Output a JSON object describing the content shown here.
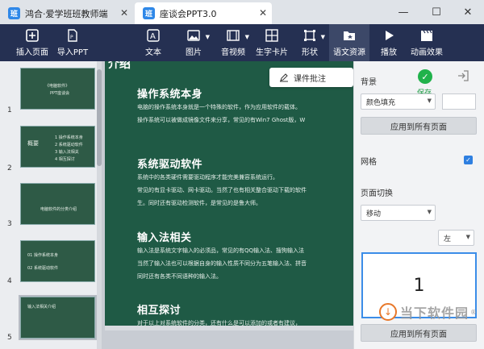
{
  "tabs": [
    {
      "logo": "班",
      "label": "鸿合·爱学班班教师端"
    },
    {
      "logo": "班",
      "label": "座谈会PPT3.0"
    }
  ],
  "window_controls": {
    "minimize": "—",
    "maximize": "☐",
    "close": "✕"
  },
  "toolbar": {
    "insert_page": "插入页面",
    "import_ppt": "导入PPT",
    "text": "文本",
    "image": "图片",
    "audio_video": "音视频",
    "word_card": "生字卡片",
    "shape": "形状",
    "language_resource": "语文资源",
    "play": "播放",
    "animation": "动画效果"
  },
  "thumbnails": [
    {
      "num": "1",
      "lines": [
        "《电脑软件》",
        "PPT座谈会"
      ]
    },
    {
      "num": "2",
      "lines": [
        "概要",
        "1 操作系统本身",
        "2 系统驱动软件",
        "3 输入法相关",
        "4 相互探讨"
      ]
    },
    {
      "num": "3",
      "lines": [
        "电脑软件的分类介绍"
      ]
    },
    {
      "num": "4",
      "lines": [
        "01 操作系统本身",
        "02 系统驱动软件"
      ]
    },
    {
      "num": "5",
      "lines": [
        "输入法相关介绍"
      ]
    }
  ],
  "slide": {
    "ghost_title": "介绍",
    "sections": [
      {
        "heading": "操作系统本身",
        "lines": [
          "电脑的操作系统本身就是一个特殊的软件，作为应用软件的载体。",
          "操作系统可以被做成镜像文件来分享，常见的有Win7 Ghost版，W"
        ]
      },
      {
        "heading": "系统驱动软件",
        "lines": [
          "系统中的各类硬件需要驱动程序才能完美兼容系统运行。",
          "常见的有显卡驱动、网卡驱动。当然了也有相关整合驱动下载的软件",
          "生。同时还有驱动检测软件，是常见的是鲁大师。"
        ]
      },
      {
        "heading": "输入法相关",
        "lines": [
          "输入法是系统文字输入的必须品，常见的有QQ输入法、搜狗输入法",
          "当然了输入法也可以根据自身的输入性质不同分为五笔输入法、拼音",
          "同时还有各类不同语种的输入法。"
        ]
      },
      {
        "heading": "相互探讨",
        "lines": [
          "对于以上对系统软件的分类，还有什么是可以添加的或者有建议，"
        ]
      }
    ]
  },
  "annotation_button": "课件批注",
  "panel": {
    "background_label": "背景",
    "fill_option": "颜色填充",
    "save_label": "保存",
    "apply_all_1": "应用到所有页面",
    "grid_label": "网格",
    "grid_checked": "✓",
    "transition_label": "页面切换",
    "transition_option": "移动",
    "direction_option": "左",
    "preview_number": "1",
    "apply_all_2": "应用到所有页面"
  },
  "watermark": {
    "text": "当下软件园",
    "reg": "®"
  },
  "colors": {
    "toolbar": "#253052",
    "slide": "#1f5a45",
    "accent": "#2f7fe0",
    "save": "#20b24b"
  }
}
